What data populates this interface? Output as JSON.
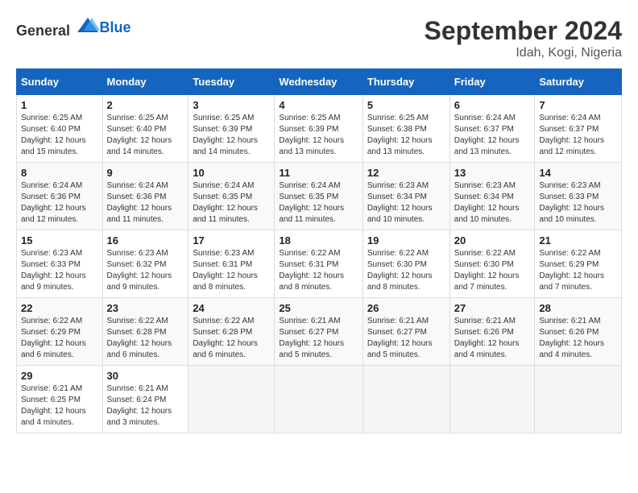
{
  "logo": {
    "text_general": "General",
    "text_blue": "Blue"
  },
  "title": "September 2024",
  "location": "Idah, Kogi, Nigeria",
  "weekdays": [
    "Sunday",
    "Monday",
    "Tuesday",
    "Wednesday",
    "Thursday",
    "Friday",
    "Saturday"
  ],
  "weeks": [
    [
      {
        "day": "1",
        "sunrise": "6:25 AM",
        "sunset": "6:40 PM",
        "daylight": "12 hours and 15 minutes."
      },
      {
        "day": "2",
        "sunrise": "6:25 AM",
        "sunset": "6:40 PM",
        "daylight": "12 hours and 14 minutes."
      },
      {
        "day": "3",
        "sunrise": "6:25 AM",
        "sunset": "6:39 PM",
        "daylight": "12 hours and 14 minutes."
      },
      {
        "day": "4",
        "sunrise": "6:25 AM",
        "sunset": "6:39 PM",
        "daylight": "12 hours and 13 minutes."
      },
      {
        "day": "5",
        "sunrise": "6:25 AM",
        "sunset": "6:38 PM",
        "daylight": "12 hours and 13 minutes."
      },
      {
        "day": "6",
        "sunrise": "6:24 AM",
        "sunset": "6:37 PM",
        "daylight": "12 hours and 13 minutes."
      },
      {
        "day": "7",
        "sunrise": "6:24 AM",
        "sunset": "6:37 PM",
        "daylight": "12 hours and 12 minutes."
      }
    ],
    [
      {
        "day": "8",
        "sunrise": "6:24 AM",
        "sunset": "6:36 PM",
        "daylight": "12 hours and 12 minutes."
      },
      {
        "day": "9",
        "sunrise": "6:24 AM",
        "sunset": "6:36 PM",
        "daylight": "12 hours and 11 minutes."
      },
      {
        "day": "10",
        "sunrise": "6:24 AM",
        "sunset": "6:35 PM",
        "daylight": "12 hours and 11 minutes."
      },
      {
        "day": "11",
        "sunrise": "6:24 AM",
        "sunset": "6:35 PM",
        "daylight": "12 hours and 11 minutes."
      },
      {
        "day": "12",
        "sunrise": "6:23 AM",
        "sunset": "6:34 PM",
        "daylight": "12 hours and 10 minutes."
      },
      {
        "day": "13",
        "sunrise": "6:23 AM",
        "sunset": "6:34 PM",
        "daylight": "12 hours and 10 minutes."
      },
      {
        "day": "14",
        "sunrise": "6:23 AM",
        "sunset": "6:33 PM",
        "daylight": "12 hours and 10 minutes."
      }
    ],
    [
      {
        "day": "15",
        "sunrise": "6:23 AM",
        "sunset": "6:33 PM",
        "daylight": "12 hours and 9 minutes."
      },
      {
        "day": "16",
        "sunrise": "6:23 AM",
        "sunset": "6:32 PM",
        "daylight": "12 hours and 9 minutes."
      },
      {
        "day": "17",
        "sunrise": "6:23 AM",
        "sunset": "6:31 PM",
        "daylight": "12 hours and 8 minutes."
      },
      {
        "day": "18",
        "sunrise": "6:22 AM",
        "sunset": "6:31 PM",
        "daylight": "12 hours and 8 minutes."
      },
      {
        "day": "19",
        "sunrise": "6:22 AM",
        "sunset": "6:30 PM",
        "daylight": "12 hours and 8 minutes."
      },
      {
        "day": "20",
        "sunrise": "6:22 AM",
        "sunset": "6:30 PM",
        "daylight": "12 hours and 7 minutes."
      },
      {
        "day": "21",
        "sunrise": "6:22 AM",
        "sunset": "6:29 PM",
        "daylight": "12 hours and 7 minutes."
      }
    ],
    [
      {
        "day": "22",
        "sunrise": "6:22 AM",
        "sunset": "6:29 PM",
        "daylight": "12 hours and 6 minutes."
      },
      {
        "day": "23",
        "sunrise": "6:22 AM",
        "sunset": "6:28 PM",
        "daylight": "12 hours and 6 minutes."
      },
      {
        "day": "24",
        "sunrise": "6:22 AM",
        "sunset": "6:28 PM",
        "daylight": "12 hours and 6 minutes."
      },
      {
        "day": "25",
        "sunrise": "6:21 AM",
        "sunset": "6:27 PM",
        "daylight": "12 hours and 5 minutes."
      },
      {
        "day": "26",
        "sunrise": "6:21 AM",
        "sunset": "6:27 PM",
        "daylight": "12 hours and 5 minutes."
      },
      {
        "day": "27",
        "sunrise": "6:21 AM",
        "sunset": "6:26 PM",
        "daylight": "12 hours and 4 minutes."
      },
      {
        "day": "28",
        "sunrise": "6:21 AM",
        "sunset": "6:26 PM",
        "daylight": "12 hours and 4 minutes."
      }
    ],
    [
      {
        "day": "29",
        "sunrise": "6:21 AM",
        "sunset": "6:25 PM",
        "daylight": "12 hours and 4 minutes."
      },
      {
        "day": "30",
        "sunrise": "6:21 AM",
        "sunset": "6:24 PM",
        "daylight": "12 hours and 3 minutes."
      },
      null,
      null,
      null,
      null,
      null
    ]
  ]
}
